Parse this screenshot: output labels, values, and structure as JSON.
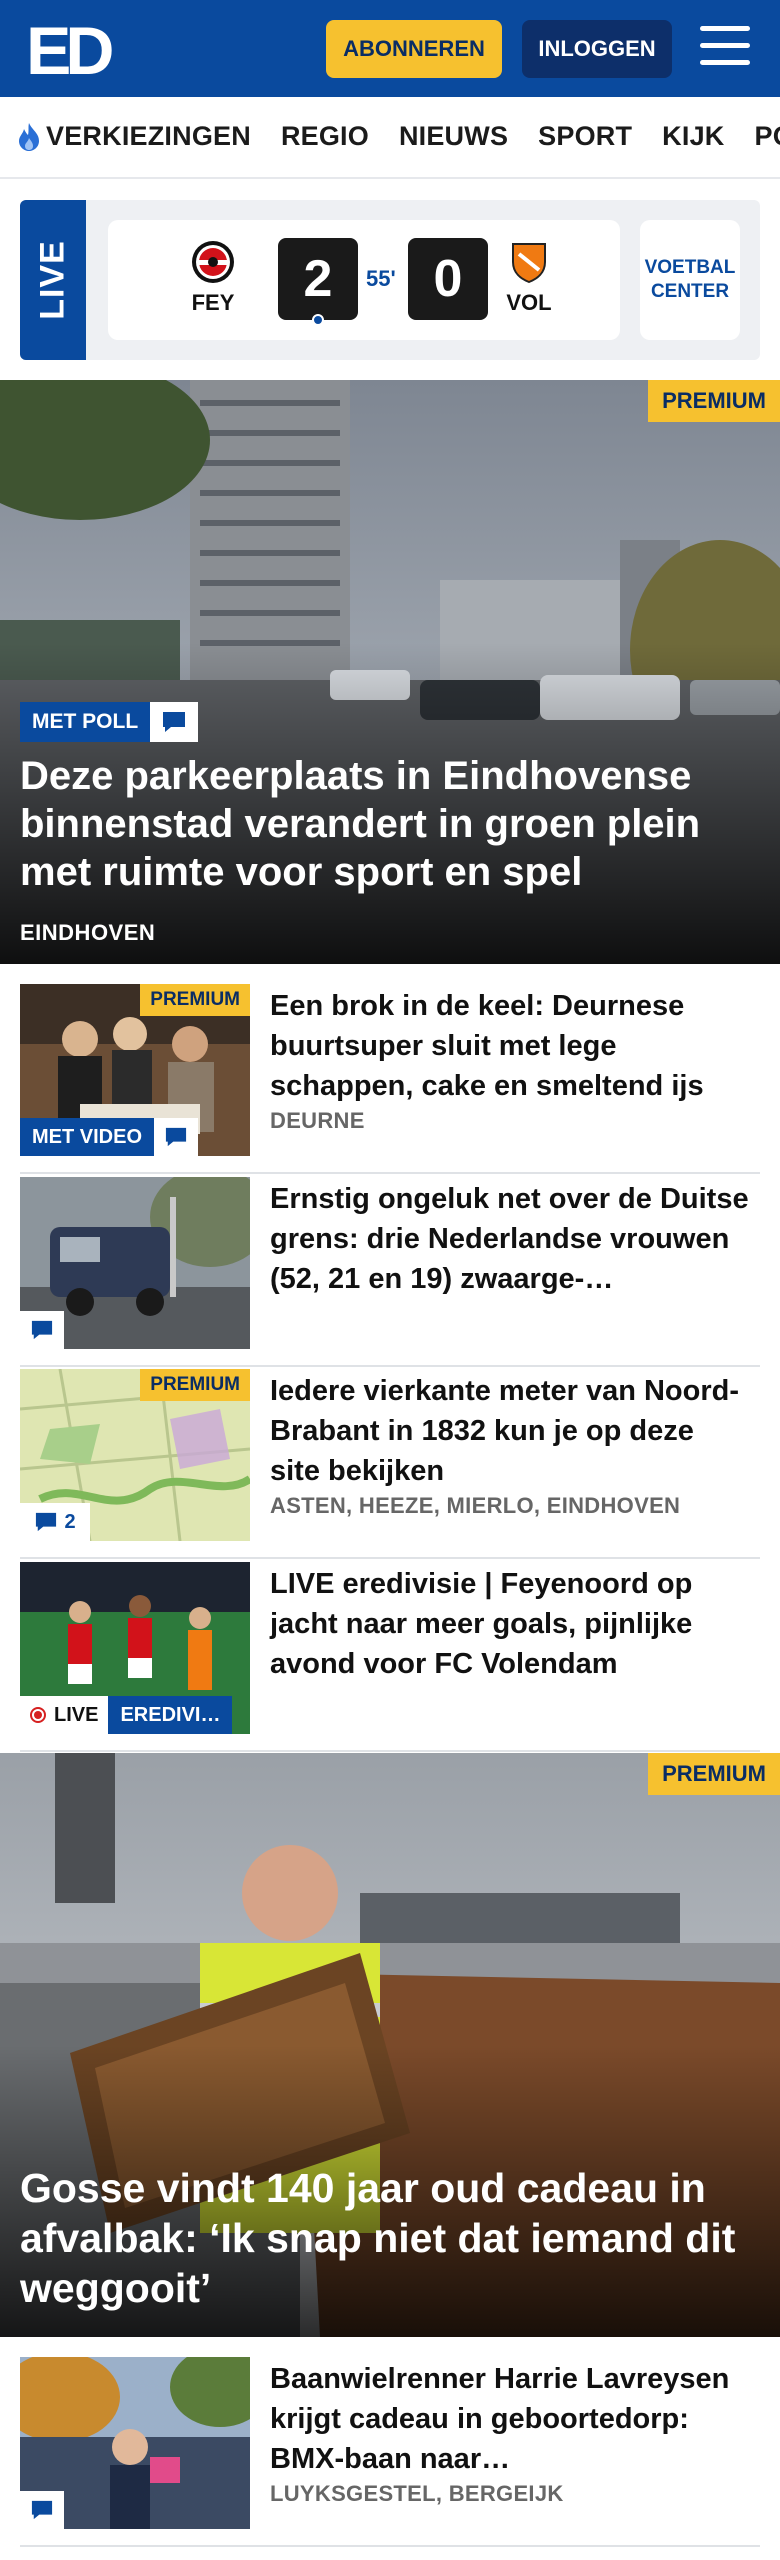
{
  "header": {
    "logo_text": "ED",
    "subscribe_label": "ABONNEREN",
    "login_label": "INLOGGEN"
  },
  "nav": {
    "items": [
      "VERKIEZINGEN",
      "REGIO",
      "NIEUWS",
      "SPORT",
      "KIJK",
      "PODCAST"
    ]
  },
  "live_score": {
    "live_label": "LIVE",
    "home_team": "FEY",
    "away_team": "VOL",
    "home_score": "2",
    "away_score": "0",
    "minute": "55'",
    "center_label": "VOETBAL CENTER"
  },
  "hero1": {
    "premium": "PREMIUM",
    "badge": "MET POLL",
    "title": "Deze parkeerplaats in Eindhovense binnenstad verandert in groen plein met ruimte voor sport en spel",
    "location": "EINDHOVEN"
  },
  "articles": [
    {
      "premium": "PREMIUM",
      "badge": "MET VIDEO",
      "title": "Een brok in de keel: Deurnese buurtsuper sluit met lege schappen, cake en smeltend ijs",
      "location": "DEURNE"
    },
    {
      "title": "Ernstig ongeluk net over de Duitse grens: drie Nederlandse vrouwen (52, 21 en 19) zwaarge-…"
    },
    {
      "premium": "PREMIUM",
      "comments": "2",
      "title": "Iedere vierkante meter van Noord-Brabant in 1832 kun je op deze site bekijken",
      "location": "ASTEN, HEEZE, MIERLO, EINDHOVEN"
    },
    {
      "live": "LIVE",
      "category": "EREDIVI…",
      "title": "LIVE eredivisie | Feyenoord op jacht naar meer goals, pijnlijke avond voor FC Volendam"
    }
  ],
  "hero2": {
    "premium": "PREMIUM",
    "title": "Gosse vindt 140 jaar oud cadeau in afvalbak: ‘Ik snap niet dat iemand dit weggooit’"
  },
  "article_last": {
    "title": "Baanwielrenner Harrie Lavreysen krijgt cadeau in geboortedorp: BMX-baan naar…",
    "location": "LUYKSGESTEL, BERGEIJK"
  },
  "colors": {
    "brand_blue": "#0a4a9e",
    "premium_yellow": "#f6c12f",
    "navy": "#0d2f6a"
  }
}
